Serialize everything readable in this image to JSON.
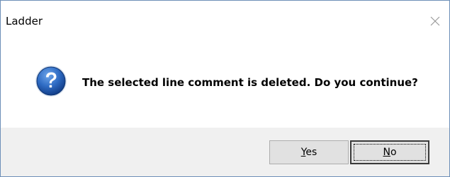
{
  "window": {
    "title": "Ladder"
  },
  "dialog": {
    "message": "The selected line comment is deleted. Do you continue?",
    "icon": "question-icon"
  },
  "buttons": {
    "yes": {
      "mnemonic": "Y",
      "rest": "es"
    },
    "no": {
      "mnemonic": "N",
      "rest": "o"
    }
  },
  "colors": {
    "icon_blue": "#1f5bb0",
    "footer_bg": "#f0f0f0",
    "button_bg": "#e1e1e1"
  }
}
